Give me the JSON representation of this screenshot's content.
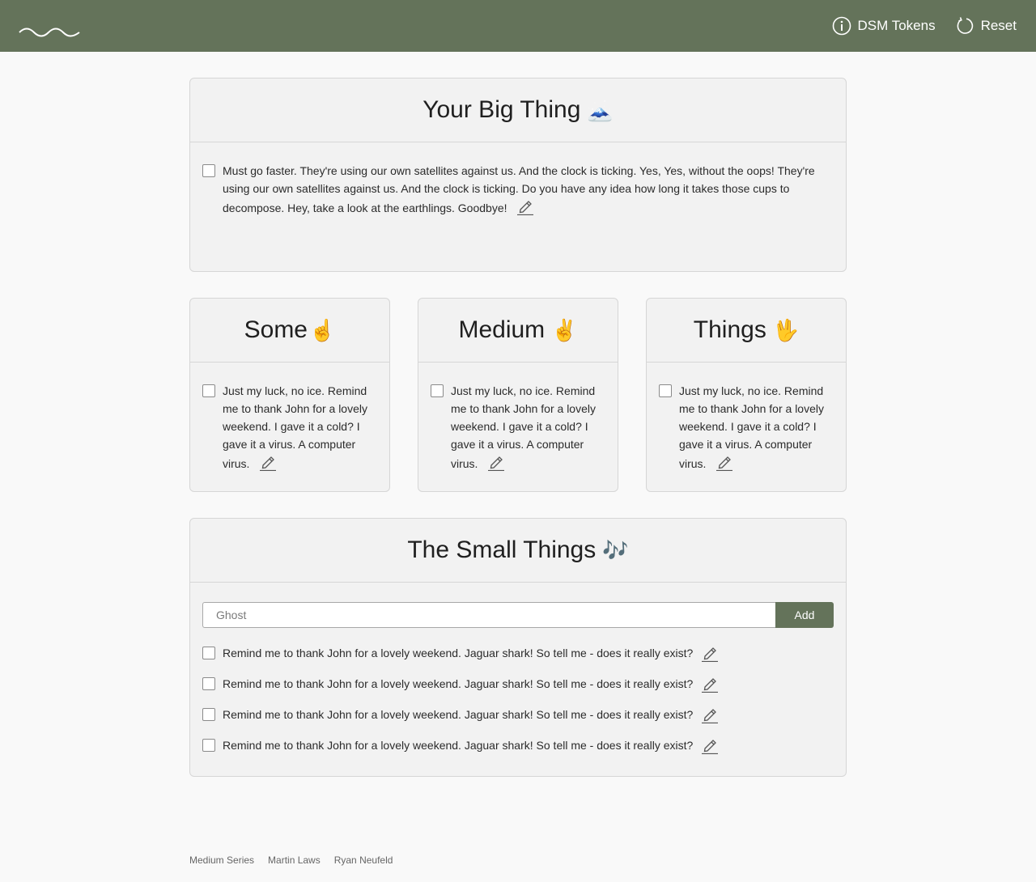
{
  "header": {
    "logo_icon": "wave-logo-icon",
    "dsm_label": "DSM Tokens",
    "dsm_icon": "info-icon",
    "reset_label": "Reset",
    "reset_icon": "refresh-icon",
    "bg_color": "#64735a"
  },
  "big_thing": {
    "title": "Your Big Thing",
    "emoji": "🗻",
    "task": "Must go faster. They're using our own satellites against us. And the clock is ticking. Yes, Yes, without the oops! They're using our own satellites against us. And the clock is ticking. Do you have any idea how long it takes those cups to decompose. Hey, take a look at the earthlings. Goodbye!"
  },
  "medium": [
    {
      "title": "Some",
      "emoji": "☝️",
      "task": "Just my luck, no ice. Remind me to thank John for a lovely weekend. I gave it a cold? I gave it a virus. A computer virus."
    },
    {
      "title": "Medium",
      "emoji": "✌️",
      "task": "Just my luck, no ice. Remind me to thank John for a lovely weekend. I gave it a cold? I gave it a virus. A computer virus."
    },
    {
      "title": "Things",
      "emoji": "🖖",
      "task": "Just my luck, no ice. Remind me to thank John for a lovely weekend. I gave it a cold? I gave it a virus. A computer virus."
    }
  ],
  "small_things": {
    "title": "The Small Things",
    "emoji": "🎶",
    "input_placeholder": "Ghost",
    "add_label": "Add",
    "tasks": [
      "Remind me to thank John for a lovely weekend. Jaguar shark! So tell me - does it really exist?",
      "Remind me to thank John for a lovely weekend. Jaguar shark! So tell me - does it really exist?",
      "Remind me to thank John for a lovely weekend. Jaguar shark! So tell me - does it really exist?",
      "Remind me to thank John for a lovely weekend. Jaguar shark! So tell me - does it really exist?"
    ]
  },
  "footer": {
    "links": [
      "Medium Series",
      "Martin Laws",
      "Ryan Neufeld"
    ]
  }
}
